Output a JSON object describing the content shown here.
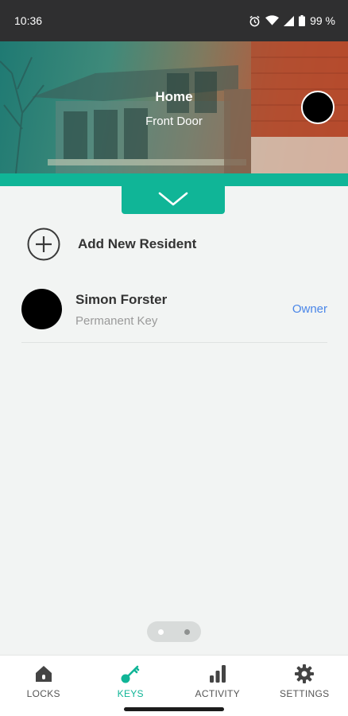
{
  "status_bar": {
    "time": "10:36",
    "battery": "99 %",
    "icons": [
      "alarm-icon",
      "wifi-icon",
      "signal-icon",
      "battery-icon"
    ]
  },
  "header": {
    "title": "Home",
    "subtitle": "Front Door"
  },
  "add_resident": {
    "label": "Add New Resident",
    "icon": "add-circle-icon"
  },
  "residents": [
    {
      "name": "Simon Forster",
      "key_type": "Permanent Key",
      "role": "Owner"
    }
  ],
  "pager": {
    "pages": 2,
    "current": 1
  },
  "bottom_nav": {
    "items": [
      {
        "label": "LOCKS",
        "icon": "house-icon",
        "active": false
      },
      {
        "label": "KEYS",
        "icon": "key-icon",
        "active": true
      },
      {
        "label": "ACTIVITY",
        "icon": "bar-chart-icon",
        "active": false
      },
      {
        "label": "SETTINGS",
        "icon": "gear-icon",
        "active": false
      }
    ]
  },
  "colors": {
    "accent": "#10b597",
    "owner_link": "#4a86e8",
    "status_bar": "#2f2f30",
    "background": "#f2f4f3"
  }
}
